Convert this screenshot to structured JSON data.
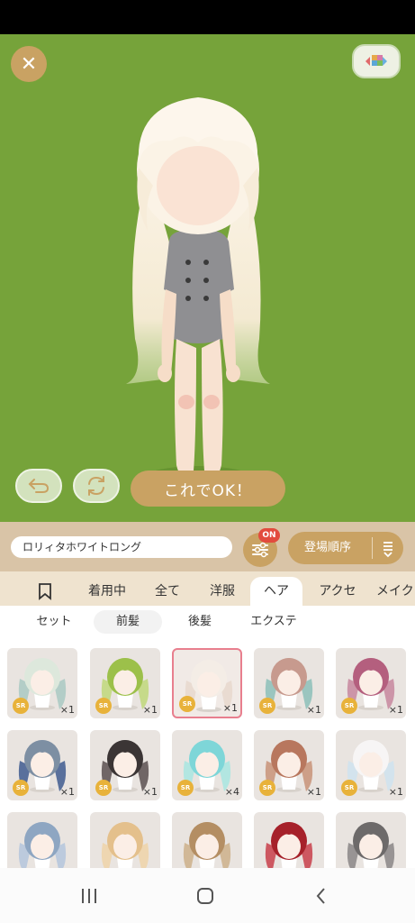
{
  "stage": {
    "background": "#76a33a",
    "ok_label": "これでOK！"
  },
  "filter_bar": {
    "item_name": "ロリィタホワイトロング",
    "filter_badge": "ON",
    "sort_label": "登場順序"
  },
  "category_tabs": [
    {
      "label": "着用中"
    },
    {
      "label": "全て"
    },
    {
      "label": "洋服"
    },
    {
      "label": "ヘア",
      "active": true
    },
    {
      "label": "アクセ"
    },
    {
      "label": "メイク"
    }
  ],
  "sub_tabs": [
    {
      "label": "セット"
    },
    {
      "label": "前髪",
      "active": true
    },
    {
      "label": "後髪"
    },
    {
      "label": "エクステ"
    }
  ],
  "items": [
    {
      "rarity": "SR",
      "count": "×1",
      "hair": "#dde8dc",
      "accent": "#a9c9c2"
    },
    {
      "rarity": "SR",
      "count": "×1",
      "hair": "#9cc04a",
      "accent": "#c0d87a"
    },
    {
      "rarity": "SR",
      "count": "×1",
      "hair": "#f4ede6",
      "accent": "#e7d8cc",
      "selected": true
    },
    {
      "rarity": "SR",
      "count": "×1",
      "hair": "#c79a8e",
      "accent": "#8cc0b8"
    },
    {
      "rarity": "SR",
      "count": "×1",
      "hair": "#b45f7e",
      "accent": "#c7879d"
    },
    {
      "rarity": "SR",
      "count": "×1",
      "hair": "#7d8fa3",
      "accent": "#3f5c8f"
    },
    {
      "rarity": "SR",
      "count": "×1",
      "hair": "#3b3535",
      "accent": "#5a5050"
    },
    {
      "rarity": "SR",
      "count": "×4",
      "hair": "#7ed6d8",
      "accent": "#a8e6e0"
    },
    {
      "rarity": "SR",
      "count": "×1",
      "hair": "#b8775e",
      "accent": "#c89378"
    },
    {
      "rarity": "SR",
      "count": "×1",
      "hair": "#f7f5f5",
      "accent": "#cfe3ef"
    },
    {
      "rarity": "",
      "count": "",
      "hair": "#8ea6c2",
      "accent": "#b4c6dc"
    },
    {
      "rarity": "",
      "count": "",
      "hair": "#e4c08c",
      "accent": "#efd3a8"
    },
    {
      "rarity": "",
      "count": "",
      "hair": "#b48e63",
      "accent": "#cdb08a"
    },
    {
      "rarity": "",
      "count": "",
      "hair": "#a6212a",
      "accent": "#c8404a"
    },
    {
      "rarity": "",
      "count": "",
      "hair": "#6d6a6a",
      "accent": "#8a8686"
    }
  ]
}
